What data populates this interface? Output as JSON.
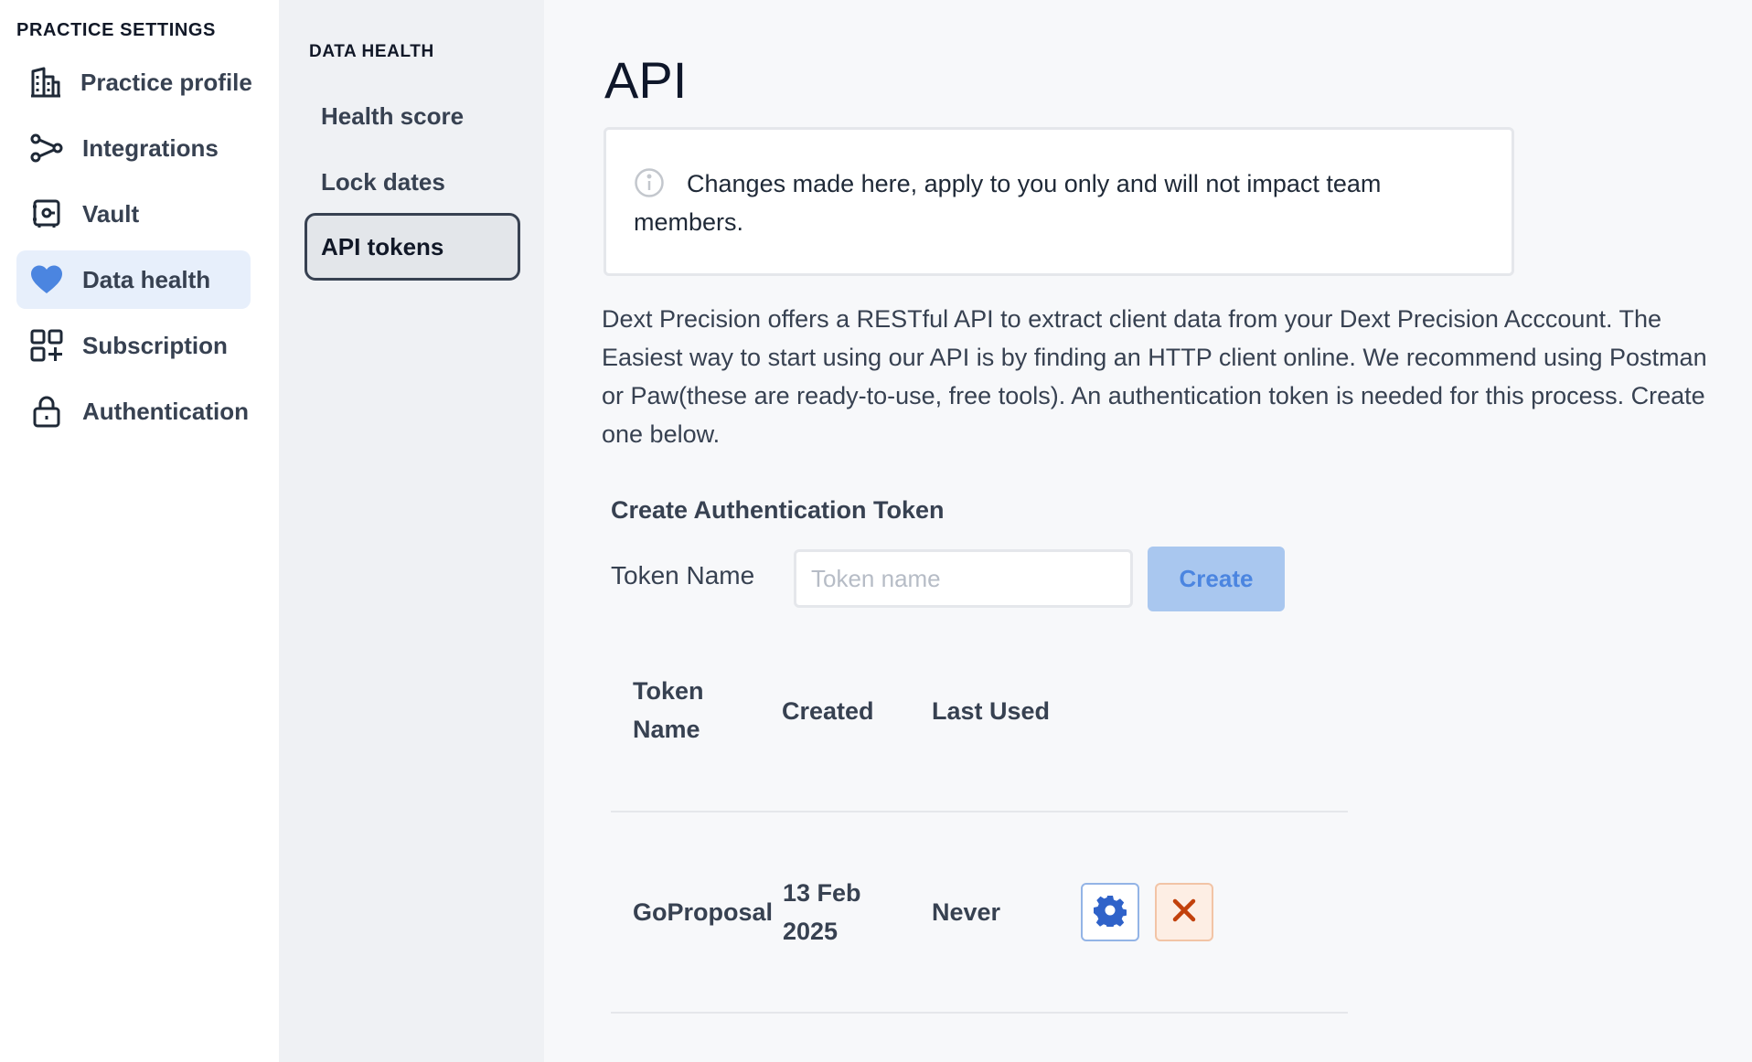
{
  "sidebar": {
    "heading": "PRACTICE SETTINGS",
    "items": [
      {
        "label": "Practice profile",
        "icon": "building-icon"
      },
      {
        "label": "Integrations",
        "icon": "integrations-icon"
      },
      {
        "label": "Vault",
        "icon": "vault-icon"
      },
      {
        "label": "Data health",
        "icon": "heart-icon",
        "active": true
      },
      {
        "label": "Subscription",
        "icon": "apps-plus-icon"
      },
      {
        "label": "Authentication",
        "icon": "lock-icon"
      }
    ]
  },
  "subnav": {
    "heading": "DATA HEALTH",
    "items": [
      {
        "label": "Health score"
      },
      {
        "label": "Lock dates"
      },
      {
        "label": "API tokens",
        "active": true
      }
    ]
  },
  "main": {
    "title": "API",
    "info": "Changes made here, apply to you only and will not impact team members.",
    "description": "Dext Precision offers a RESTful API to extract client data from your Dext Precision Acccount. The Easiest way to start using our API is by finding an HTTP client online. We recommend using Postman or Paw(these are ready-to-use, free tools). An authentication token is needed for this process. Create one below.",
    "create": {
      "title": "Create Authentication Token",
      "label": "Token Name",
      "placeholder": "Token name",
      "value": "",
      "button": "Create"
    },
    "table": {
      "headers": [
        "Token Name",
        "Created",
        "Last Used"
      ],
      "rows": [
        {
          "name": "GoProposal",
          "created": "13 Feb 2025",
          "last_used": "Never"
        }
      ]
    }
  },
  "colors": {
    "accent": "#4b85e0",
    "active_bg": "#e7effb",
    "delete": "#c2410c"
  }
}
